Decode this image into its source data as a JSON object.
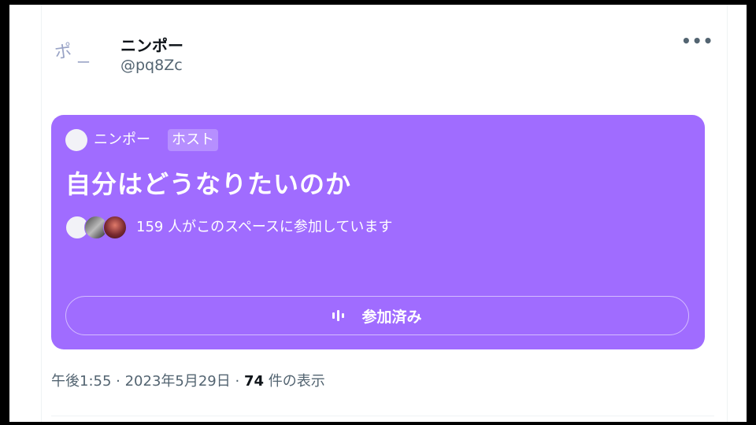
{
  "tweet": {
    "author_name": "ニンポー",
    "author_handle": "@pq8Zc",
    "avatar_text_1": "ポ",
    "avatar_text_2": "ー",
    "more_label": "•••"
  },
  "space": {
    "host_name": "ニンポー",
    "host_badge": "ホスト",
    "title": "自分はどうなりたいのか",
    "listener_count_text": "159 人がこのスペースに参加しています",
    "join_button_label": "参加済み",
    "card_color": "#a06cff"
  },
  "meta": {
    "time": "午後1:55",
    "sep1": " · ",
    "date": "2023年5月29日",
    "sep2": " · ",
    "views_count": "74",
    "views_label": " 件の表示"
  }
}
